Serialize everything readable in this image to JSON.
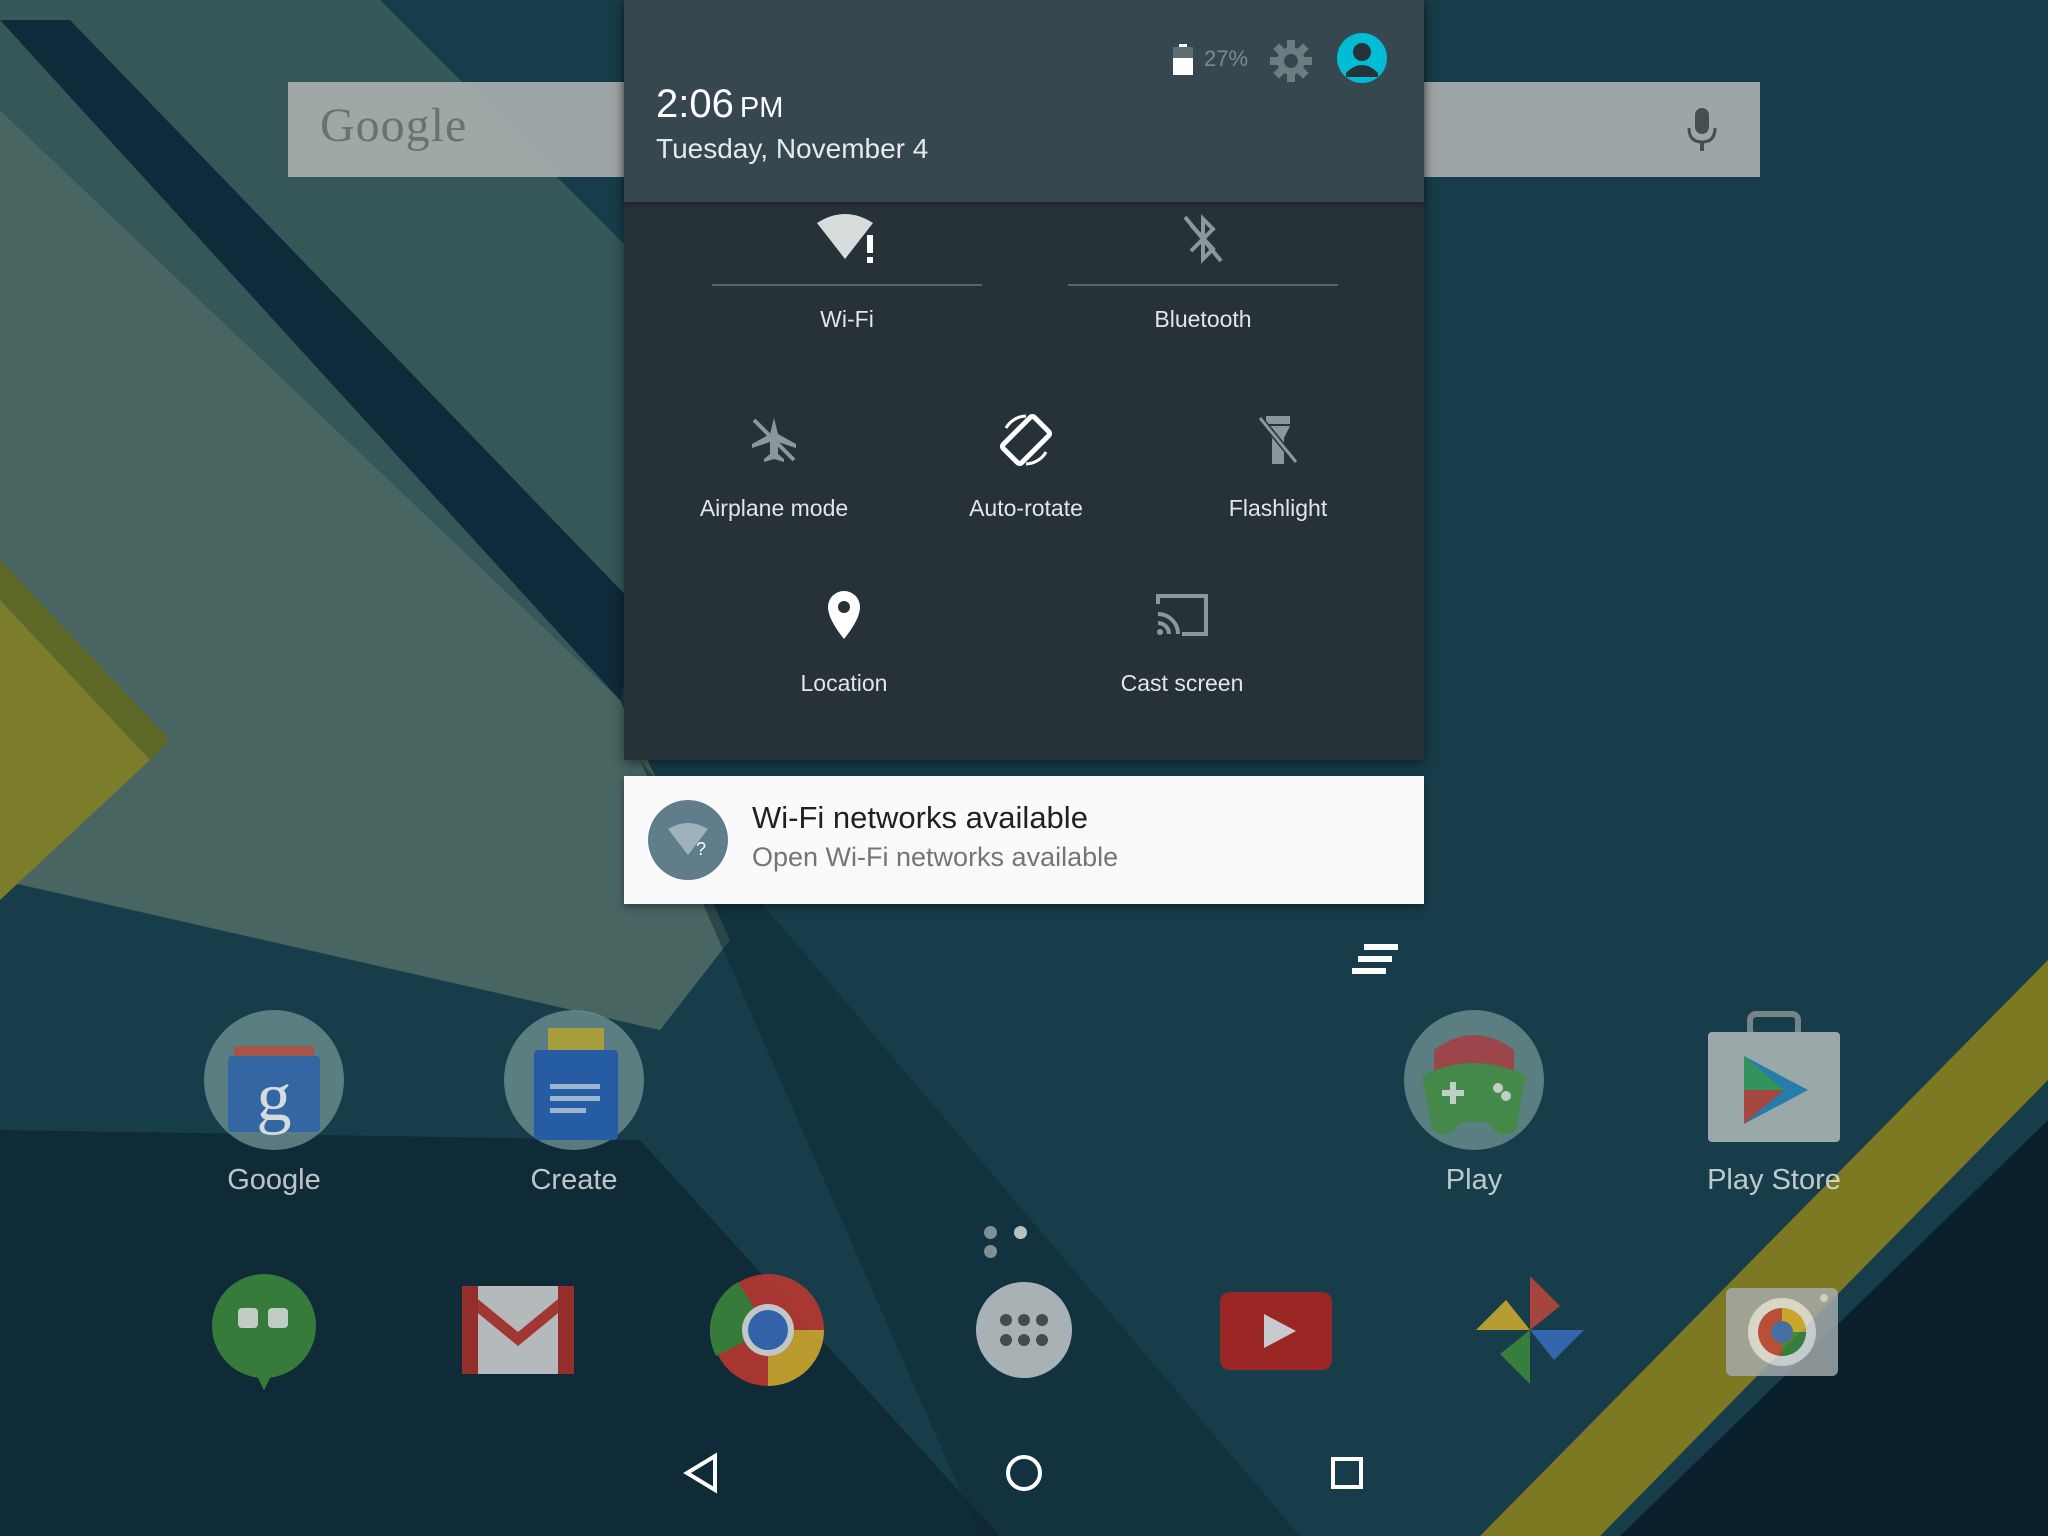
{
  "search": {
    "logo": "Google"
  },
  "home_apps": [
    {
      "label": "Google",
      "icon": "google-search-icon"
    },
    {
      "label": "Create",
      "icon": "docs-folder-icon"
    },
    {
      "label": "Play",
      "icon": "play-games-icon"
    },
    {
      "label": "Play Store",
      "icon": "play-store-icon"
    }
  ],
  "dock": [
    {
      "icon": "hangouts-icon"
    },
    {
      "icon": "gmail-icon"
    },
    {
      "icon": "chrome-icon"
    },
    {
      "icon": "app-drawer-icon"
    },
    {
      "icon": "youtube-icon"
    },
    {
      "icon": "photos-icon"
    },
    {
      "icon": "camera-icon"
    }
  ],
  "page_indicator": {
    "pages": 3,
    "active": 2
  },
  "status": {
    "time": "2:06",
    "ampm": "PM",
    "date": "Tuesday, November 4",
    "battery_percent": "27%"
  },
  "quick_settings": {
    "wifi": "Wi-Fi",
    "bluetooth": "Bluetooth",
    "airplane": "Airplane mode",
    "autorotate": "Auto-rotate",
    "flashlight": "Flashlight",
    "location": "Location",
    "cast": "Cast screen"
  },
  "notification": {
    "title": "Wi-Fi networks available",
    "text": "Open Wi-Fi networks available",
    "icon_color": "#607d8b"
  },
  "colors": {
    "accent": "#00bcd4",
    "shade_bg": "#263238",
    "shade_header": "#37474f"
  }
}
